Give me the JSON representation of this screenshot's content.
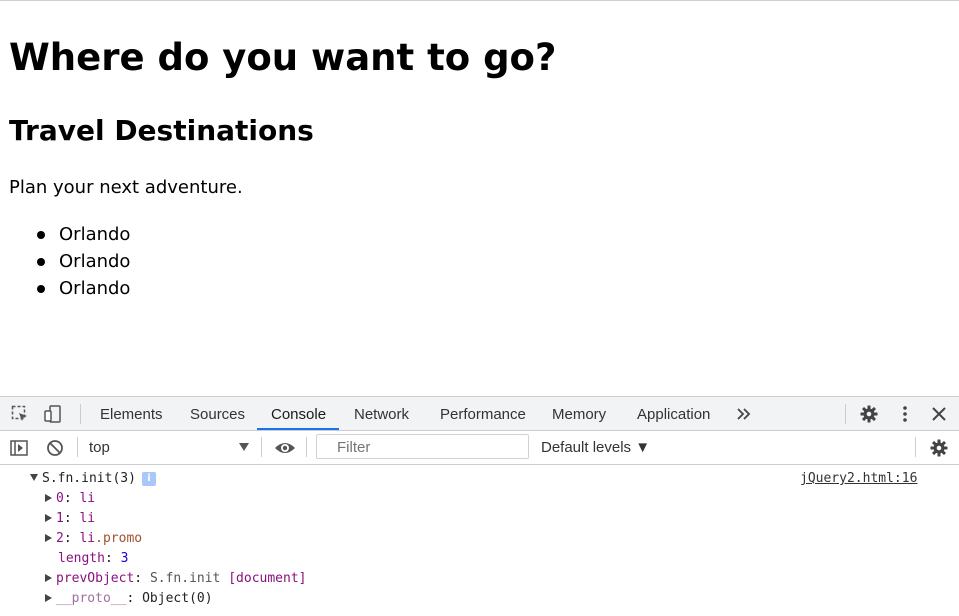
{
  "page": {
    "heading1": "Where do you want to go?",
    "heading2": "Travel Destinations",
    "paragraph": "Plan your next adventure.",
    "list_items": [
      "Orlando",
      "Orlando",
      "Orlando"
    ]
  },
  "devtools": {
    "tabs": [
      "Elements",
      "Sources",
      "Console",
      "Network",
      "Performance",
      "Memory",
      "Application"
    ],
    "active_tab": "Console",
    "more_tabs_icon": "double-chevron-right",
    "toolbar": {
      "context": "top",
      "filter_placeholder": "Filter",
      "levels": "Default levels ▼"
    },
    "console": {
      "root": "S.fn.init(3)",
      "info_badge": "i",
      "source_link": "jQuery2.html:16",
      "entries": [
        {
          "key": "0",
          "value": "li"
        },
        {
          "key": "1",
          "value": "li"
        },
        {
          "key": "2",
          "value": "li",
          "cls": ".promo"
        }
      ],
      "length_key": "length",
      "length_value": "3",
      "prev_key": "prevObject",
      "prev_value": "S.fn.init",
      "prev_extra": "[document]",
      "proto_key": "__proto__",
      "proto_value": "Object(0)"
    },
    "accent_color": "#1a73e8"
  }
}
